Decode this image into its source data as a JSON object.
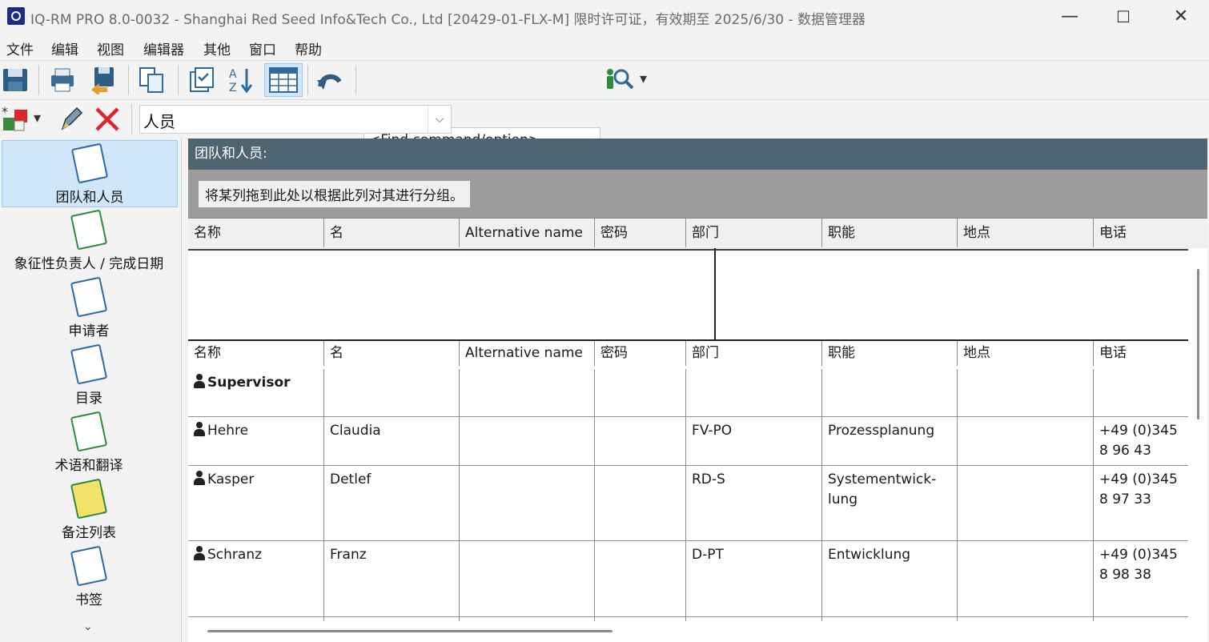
{
  "window": {
    "title": "IQ-RM PRO 8.0-0032 - Shanghai Red Seed Info&Tech Co., Ltd [20429-01-FLX-M] 限时许可证，有效期至 2025/6/30 - 数据管理器",
    "min_glyph": "—",
    "max_glyph": "☐",
    "close_glyph": "✕"
  },
  "menu": [
    "文件",
    "编辑",
    "视图",
    "编辑器",
    "其他",
    "窗口",
    "帮助"
  ],
  "toolbar": {
    "find_placeholder": "<Find command/option>",
    "dropdown_glyph": "▾"
  },
  "object_selector": {
    "value": "人员",
    "arrow_glyph": "⌵"
  },
  "sidebar": {
    "items": [
      {
        "label": "团队和人员",
        "icon": "team-icon",
        "active": true
      },
      {
        "label": "象征性负责人 / 完成日期",
        "icon": "xyz-icon",
        "active": false
      },
      {
        "label": "申请者",
        "icon": "applicant-icon",
        "active": false
      },
      {
        "label": "目录",
        "icon": "catalog-icon",
        "active": false
      },
      {
        "label": "术语和翻译",
        "icon": "glossary-icon",
        "active": false
      },
      {
        "label": "备注列表",
        "icon": "notes-icon",
        "active": false
      },
      {
        "label": "书签",
        "icon": "bookmark-icon",
        "active": false
      }
    ],
    "more_glyph": "⌄"
  },
  "panel": {
    "title": "团队和人员:",
    "group_hint": "将某列拖到此处以根据此列对其进行分组。"
  },
  "grid": {
    "columns": [
      "名称",
      "名",
      "Alternative name",
      "密码",
      "部门",
      "职能",
      "地点",
      "电话"
    ],
    "rows": [
      {
        "name": "Supervisor",
        "bold": true,
        "first": "",
        "alt": "",
        "password": "",
        "dept": "",
        "function": "",
        "location": "",
        "phone": ""
      },
      {
        "name": "Hehre",
        "bold": false,
        "first": "Claudia",
        "alt": "",
        "password": "",
        "dept": "FV-PO",
        "function": "Prozessplanung",
        "location": "",
        "phone": "+49 (0)345 8 96 43"
      },
      {
        "name": "Kasper",
        "bold": false,
        "first": "Detlef",
        "alt": "",
        "password": "",
        "dept": "RD-S",
        "function": "Systementwick-lung",
        "location": "",
        "phone": "+49 (0)345 8 97 33"
      },
      {
        "name": "Schranz",
        "bold": false,
        "first": "Franz",
        "alt": "",
        "password": "",
        "dept": "D-PT",
        "function": "Entwicklung",
        "location": "",
        "phone": "+49 (0)345 8 98 38"
      }
    ]
  },
  "colors": {
    "header_bg": "#4e6470",
    "active_nav_bg": "#cfe6fb",
    "group_area_bg": "#9c9c9c",
    "delete_red": "#e0242d"
  }
}
